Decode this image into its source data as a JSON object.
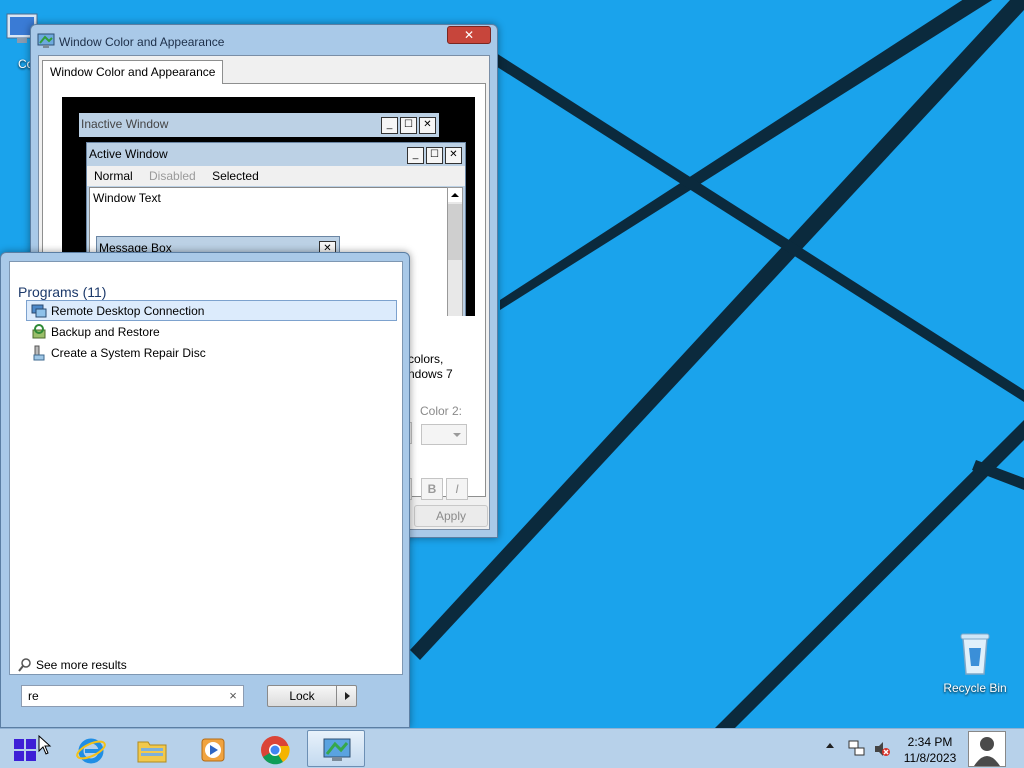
{
  "desktop": {
    "icons": [
      {
        "name": "control-panel-desktop-icon",
        "label": "Col"
      },
      {
        "name": "recycle-bin-desktop-icon",
        "label": "Recycle Bin"
      }
    ]
  },
  "wca_dialog": {
    "title": "Window Color and Appearance",
    "close_label": "✕",
    "tab_label": "Window Color and Appearance",
    "preview": {
      "inactive_title": "Inactive Window",
      "active_title": "Active Window",
      "menu": {
        "normal": "Normal",
        "disabled": "Disabled",
        "selected": "Selected"
      },
      "window_text": "Window Text",
      "message_box_title": "Message Box"
    },
    "partial_text": {
      "line1": "colors,",
      "line2": "ndows 7"
    },
    "color2_label": "Color 2:",
    "bold_label": "B",
    "italic_label": "I",
    "apply_label": "Apply"
  },
  "start_menu": {
    "group_title": "Programs (11)",
    "items": [
      {
        "label": "Remote Desktop Connection",
        "selected": true,
        "icon": "remote-desktop-icon"
      },
      {
        "label": "Backup and Restore",
        "selected": false,
        "icon": "backup-restore-icon"
      },
      {
        "label": "Create a System Repair Disc",
        "selected": false,
        "icon": "repair-disc-icon"
      }
    ],
    "see_more_label": "See more results",
    "search_value": "re",
    "search_clear": "×",
    "lock_label": "Lock"
  },
  "taskbar": {
    "apps": [
      {
        "name": "internet-explorer",
        "icon": "ie-icon",
        "active": false
      },
      {
        "name": "file-explorer",
        "icon": "folder-icon",
        "active": false
      },
      {
        "name": "media-player",
        "icon": "media-player-icon",
        "active": false
      },
      {
        "name": "chrome",
        "icon": "chrome-icon",
        "active": false
      },
      {
        "name": "personalization",
        "icon": "display-icon",
        "active": true
      }
    ],
    "clock_time": "2:34 PM",
    "clock_date": "11/8/2023"
  },
  "colors": {
    "desktop": "#1aa3ec",
    "wallpaper_line": "#0b2a3d",
    "taskbar": "#b7d1ea",
    "window_frame": "#a9c9e8",
    "close_button": "#c7453b",
    "selection": "#dcebfc"
  }
}
